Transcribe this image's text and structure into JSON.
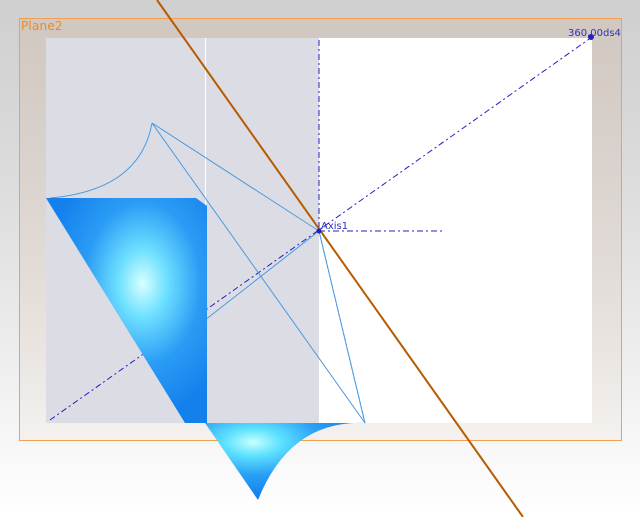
{
  "plane": {
    "label": "Plane2"
  },
  "annotations": {
    "endpoint_label": "360.00ds4",
    "axis_label": "Axis1"
  },
  "colors": {
    "plane_border": "#f0a050",
    "plane_label": "#f08a20",
    "axis_line": "#b85a00",
    "centerline": "#2020c0",
    "sketch_line": "#4a9ae0",
    "surface": "#1a8cf0"
  }
}
